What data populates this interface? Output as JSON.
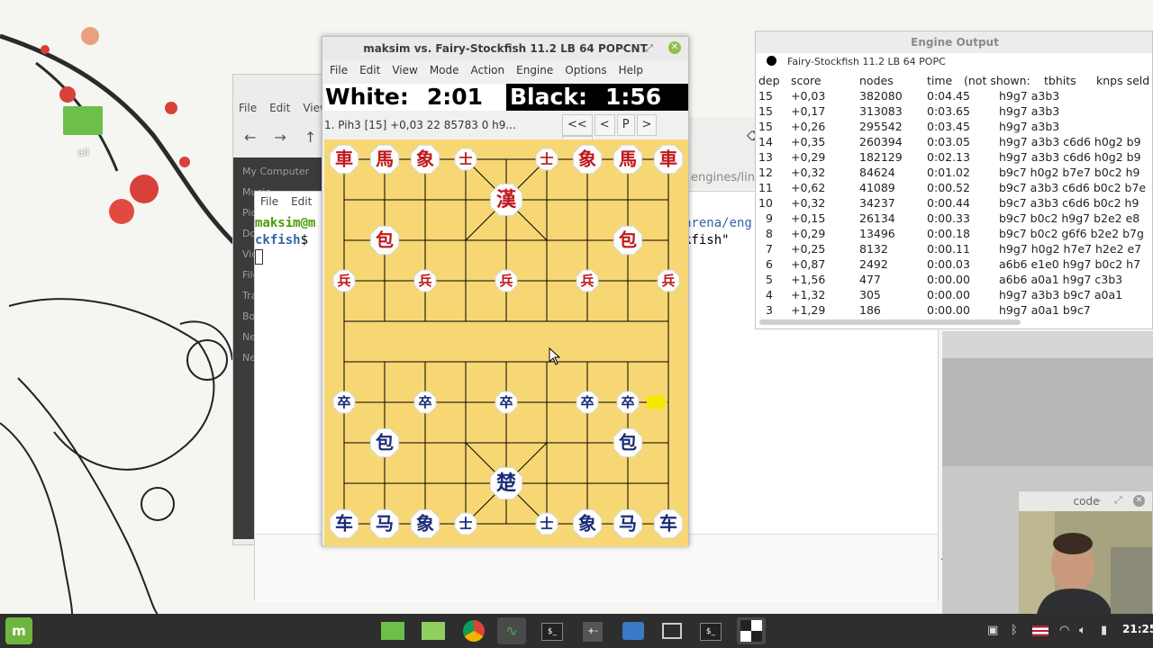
{
  "desktop": {
    "icon_label": "all"
  },
  "file_manager": {
    "menu": [
      "File",
      "Edit",
      "View"
    ],
    "sidebar": [
      "My Computer",
      "Music",
      "Pictures",
      "Downloads",
      "Videos",
      "File System",
      "Trash",
      "Bookmarks",
      "Network",
      "Network"
    ]
  },
  "terminal": {
    "menu": [
      "File",
      "Edit"
    ],
    "prompt_user": "maksim@m",
    "prompt_path": "ckfish",
    "prompt_symbol": "$",
    "right_line1": "arena/eng",
    "right_line2": "kfish\""
  },
  "bg_window": {
    "label": "engines/lin"
  },
  "xboard": {
    "title": "maksim vs. Fairy-Stockfish 11.2 LB 64 POPCNT",
    "menu": [
      "File",
      "Edit",
      "View",
      "Mode",
      "Action",
      "Engine",
      "Options",
      "Help"
    ],
    "white_label": "White:",
    "white_time": "2:01",
    "black_label": "Black:",
    "black_time": "1:56",
    "move_text": "1. Pih3  [15] +0,03 22 85783 0   h9...",
    "nav": [
      "<<",
      "<",
      "P",
      ">",
      ">>"
    ]
  },
  "board": {
    "red_pieces": [
      {
        "glyph": "車",
        "file": 0,
        "rank": 0
      },
      {
        "glyph": "馬",
        "file": 1,
        "rank": 0
      },
      {
        "glyph": "象",
        "file": 2,
        "rank": 0
      },
      {
        "glyph": "士",
        "file": 3,
        "rank": 0
      },
      {
        "glyph": "士",
        "file": 5,
        "rank": 0
      },
      {
        "glyph": "象",
        "file": 6,
        "rank": 0
      },
      {
        "glyph": "馬",
        "file": 7,
        "rank": 0
      },
      {
        "glyph": "車",
        "file": 8,
        "rank": 0
      },
      {
        "glyph": "漢",
        "file": 4,
        "rank": 1
      },
      {
        "glyph": "包",
        "file": 1,
        "rank": 2
      },
      {
        "glyph": "包",
        "file": 7,
        "rank": 2
      },
      {
        "glyph": "兵",
        "file": 0,
        "rank": 3
      },
      {
        "glyph": "兵",
        "file": 2,
        "rank": 3
      },
      {
        "glyph": "兵",
        "file": 4,
        "rank": 3
      },
      {
        "glyph": "兵",
        "file": 6,
        "rank": 3
      },
      {
        "glyph": "兵",
        "file": 8,
        "rank": 3
      }
    ],
    "blue_pieces": [
      {
        "glyph": "卒",
        "file": 0,
        "rank": 6
      },
      {
        "glyph": "卒",
        "file": 2,
        "rank": 6
      },
      {
        "glyph": "卒",
        "file": 4,
        "rank": 6
      },
      {
        "glyph": "卒",
        "file": 6,
        "rank": 6
      },
      {
        "glyph": "卒",
        "file": 7,
        "rank": 6
      },
      {
        "glyph": "包",
        "file": 1,
        "rank": 7
      },
      {
        "glyph": "包",
        "file": 7,
        "rank": 7
      },
      {
        "glyph": "楚",
        "file": 4,
        "rank": 8
      },
      {
        "glyph": "车",
        "file": 0,
        "rank": 9
      },
      {
        "glyph": "马",
        "file": 1,
        "rank": 9
      },
      {
        "glyph": "象",
        "file": 2,
        "rank": 9
      },
      {
        "glyph": "士",
        "file": 3,
        "rank": 9
      },
      {
        "glyph": "士",
        "file": 5,
        "rank": 9
      },
      {
        "glyph": "象",
        "file": 6,
        "rank": 9
      },
      {
        "glyph": "马",
        "file": 7,
        "rank": 9
      },
      {
        "glyph": "车",
        "file": 8,
        "rank": 9
      }
    ],
    "last_move_from": {
      "file": 8,
      "rank": 6
    },
    "colors": {
      "board": "#f7d774",
      "red": "#c0171d",
      "blue": "#1a2a7a",
      "arrow": "#f5e800"
    }
  },
  "engine_output": {
    "title": "Engine Output",
    "engine_name": "Fairy-Stockfish 11.2 LB 64 POPC",
    "headers": {
      "dep": "dep",
      "score": "score",
      "nodes": "nodes",
      "time": "time",
      "not_shown": "(not shown:",
      "tbhits": "tbhits",
      "knps": "knps seld"
    },
    "rows": [
      {
        "dep": "15",
        "score": "+0,03",
        "nodes": "382080",
        "time": "0:04.45",
        "pv": "h9g7 a3b3"
      },
      {
        "dep": "15",
        "score": "+0,17",
        "nodes": "313083",
        "time": "0:03.65",
        "pv": "h9g7 a3b3"
      },
      {
        "dep": "15",
        "score": "+0,26",
        "nodes": "295542",
        "time": "0:03.45",
        "pv": "h9g7 a3b3"
      },
      {
        "dep": "14",
        "score": "+0,35",
        "nodes": "260394",
        "time": "0:03.05",
        "pv": "h9g7 a3b3 c6d6 h0g2 b9"
      },
      {
        "dep": "13",
        "score": "+0,29",
        "nodes": "182129",
        "time": "0:02.13",
        "pv": "h9g7 a3b3 c6d6 h0g2 b9"
      },
      {
        "dep": "12",
        "score": "+0,32",
        "nodes": "84624",
        "time": "0:01.02",
        "pv": "b9c7 h0g2 b7e7 b0c2 h9"
      },
      {
        "dep": "11",
        "score": "+0,62",
        "nodes": "41089",
        "time": "0:00.52",
        "pv": "b9c7 a3b3 c6d6 b0c2 b7e"
      },
      {
        "dep": "10",
        "score": "+0,32",
        "nodes": "34237",
        "time": "0:00.44",
        "pv": "b9c7 a3b3 c6d6 b0c2 h9"
      },
      {
        "dep": "9",
        "score": "+0,15",
        "nodes": "26134",
        "time": "0:00.33",
        "pv": "b9c7 b0c2 h9g7 b2e2 e8"
      },
      {
        "dep": "8",
        "score": "+0,29",
        "nodes": "13496",
        "time": "0:00.18",
        "pv": "b9c7 b0c2 g6f6 b2e2 b7g"
      },
      {
        "dep": "7",
        "score": "+0,25",
        "nodes": "8132",
        "time": "0:00.11",
        "pv": "h9g7 h0g2 h7e7 h2e2 e7"
      },
      {
        "dep": "6",
        "score": "+0,87",
        "nodes": "2492",
        "time": "0:00.03",
        "pv": "a6b6 e1e0 h9g7 b0c2 h7"
      },
      {
        "dep": "5",
        "score": "+1,56",
        "nodes": "477",
        "time": "0:00.00",
        "pv": "a6b6 a0a1 h9g7 c3b3"
      },
      {
        "dep": "4",
        "score": "+1,32",
        "nodes": "305",
        "time": "0:00.00",
        "pv": "h9g7 a3b3 b9c7 a0a1"
      },
      {
        "dep": "3",
        "score": "+1,29",
        "nodes": "186",
        "time": "0:00.00",
        "pv": "h9g7 a0a1 b9c7"
      }
    ]
  },
  "webcam": {
    "title": "code"
  },
  "taskbar": {
    "menu_label": "m",
    "apps": [
      "folder",
      "files",
      "chrome",
      "monitor",
      "terminal",
      "calculator",
      "screenshot",
      "window",
      "terminal2",
      "xboard"
    ],
    "clock": "21:25"
  }
}
